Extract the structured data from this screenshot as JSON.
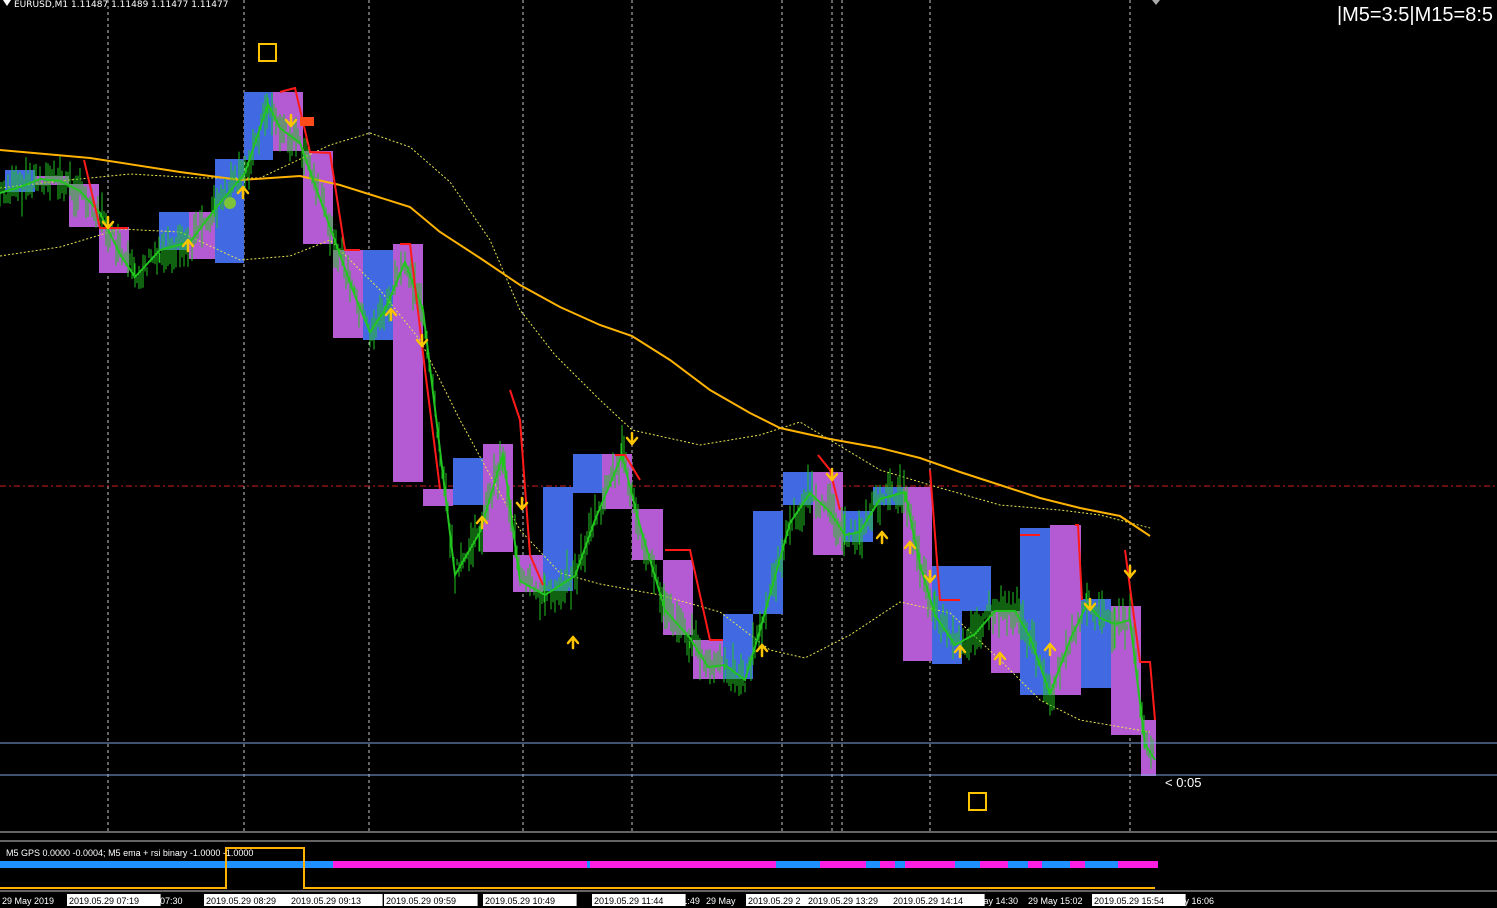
{
  "header": {
    "symbol_label": "EURUSD,M1",
    "prices": "1.11487 1.11489 1.11477 1.11477",
    "counter": "|M5=3:5|M15=8:5",
    "timer": "< 0:05"
  },
  "indicator": {
    "label": "M5 GPS 0.0000 -0.0004; M5 ema + rsi binary -1.0000 -1.0000"
  },
  "time_axis": {
    "labels": [
      "29 May 2019",
      "2019.05.29 07:19",
      "ay 07:30",
      "2019.05.29 08:29",
      "2019.05.29 09:13",
      "2019.05.29 09:59",
      "2019.05.29 10:49",
      "2019.05.29 11:44",
      "11:49",
      "29 May",
      "2019.05.29 2",
      "2019.05.29 13:29",
      "2019.05.29 14:14",
      "May 14:30",
      "29 May 15:02",
      "2019.05.29 15:54",
      "May 16:06"
    ]
  },
  "colors": {
    "background": "#000000",
    "bull_box": "#4169e1",
    "bear_box": "#b45ad2",
    "price_line": "#22c41f",
    "signal_red": "#ff1a1a",
    "arrow": "#ffc400",
    "ma_slow": "#ffb300",
    "bands": "#e6e64d",
    "level_line": "#7ea6e0",
    "bar_blue": "#1e90ff",
    "bar_magenta": "#ff1fe0"
  },
  "chart_data": {
    "type": "line",
    "title": "EURUSD,M1",
    "x_label_times": [
      "07:19",
      "08:29",
      "09:13",
      "09:59",
      "10:49",
      "11:44",
      "13:29",
      "14:14",
      "15:02",
      "15:54"
    ],
    "price_series": [
      1.1162,
      1.1163,
      1.1165,
      1.116,
      1.1161,
      1.1163,
      1.117,
      1.1168,
      1.1163,
      1.1158,
      1.1157,
      1.115,
      1.1143,
      1.1147,
      1.1144,
      1.114,
      1.1142,
      1.1139,
      1.1141,
      1.1144,
      1.1141,
      1.1137,
      1.1135,
      1.1136,
      1.114,
      1.1142,
      1.114,
      1.1142,
      1.1136,
      1.1132,
      1.1135,
      1.1137,
      1.1134,
      1.114,
      1.1138,
      1.1137,
      1.1141,
      1.1135,
      1.1131
    ],
    "timer": "< 0:05"
  }
}
